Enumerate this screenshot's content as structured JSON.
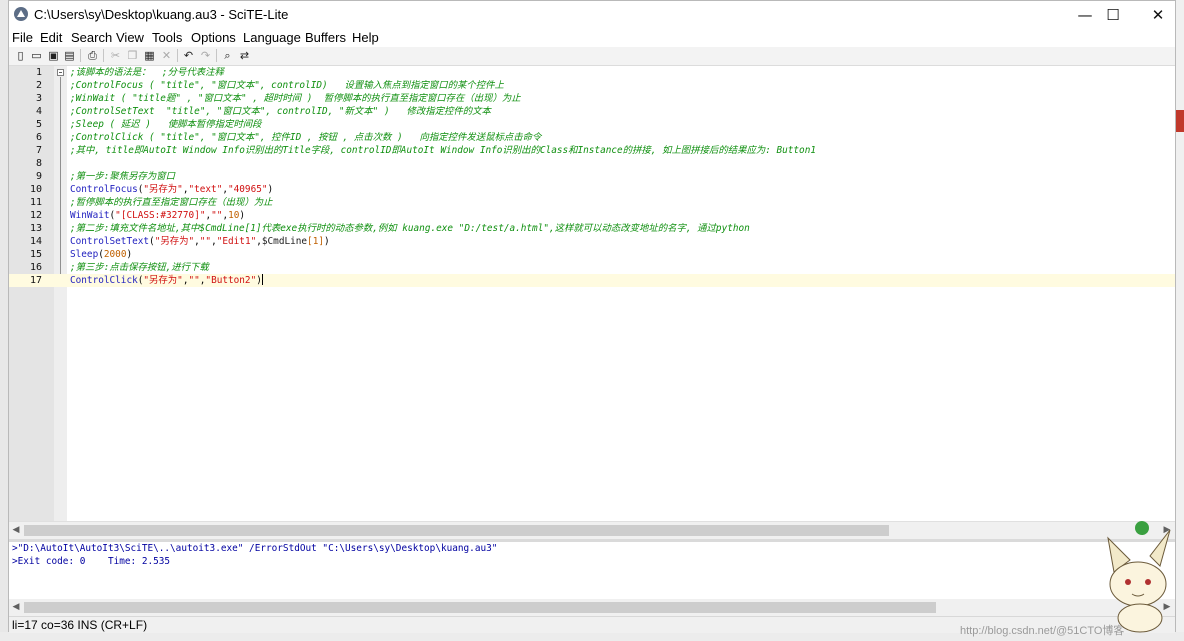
{
  "window": {
    "title": "C:\\Users\\sy\\Desktop\\kuang.au3 - SciTE-Lite",
    "minimize": "—",
    "maximize": "☐",
    "close": "✕"
  },
  "menu": [
    "File",
    "Edit",
    "Search",
    "View",
    "Tools",
    "Options",
    "Language",
    "Buffers",
    "Help"
  ],
  "toolbar_icons": [
    "new-file-icon",
    "open-folder-icon",
    "save-icon",
    "save-as-icon",
    "print-icon",
    "cut-icon",
    "copy-icon",
    "paste-icon",
    "delete-icon",
    "undo-icon",
    "redo-icon",
    "find-icon",
    "replace-icon"
  ],
  "editor": {
    "line_numbers": [
      "1",
      "2",
      "3",
      "4",
      "5",
      "6",
      "7",
      "8",
      "9",
      "10",
      "11",
      "12",
      "13",
      "14",
      "15",
      "16",
      "17"
    ],
    "lines": {
      "l1": ";该脚本的语法是：  ;分号代表注释",
      "l2": ";ControlFocus ( \"title\", \"窗口文本\", controlID)   设置输入焦点到指定窗口的某个控件上",
      "l3": ";WinWait ( \"title题\" , \"窗口文本\" , 超时时间 )  暂停脚本的执行直至指定窗口存在（出现）为止",
      "l4": ";ControlSetText  \"title\", \"窗口文本\", controlID, \"新文本\" )   修改指定控件的文本",
      "l5": ";Sleep ( 延迟 )   使脚本暂停指定时间段",
      "l6": ";ControlClick ( \"title\", \"窗口文本\", 控件ID , 按钮 , 点击次数 )   向指定控件发送鼠标点击命令",
      "l7": ";其中, title即AutoIt Window Info识别出的Title字段, controlID即AutoIt Window Info识别出的Class和Instance的拼接, 如上图拼接后的结果应为: Button1",
      "l9": ";第一步:聚焦另存为窗口",
      "l10": {
        "fn": "ControlFocus",
        "open": "(",
        "s1": "\"另存为\"",
        "c1": ",",
        "s2": "\"text\"",
        "c2": ",",
        "s3": "\"40965\"",
        "close": ")"
      },
      "l11": ";暂停脚本的执行直至指定窗口存在（出现）为止",
      "l12": {
        "fn": "WinWait",
        "open": "(",
        "s1": "\"[CLASS:#32770]\"",
        "c1": ",",
        "s2": "\"\"",
        "c2": ",",
        "n1": "10",
        "close": ")"
      },
      "l13": ";第二步:填充文件名地址,其中$CmdLine[1]代表exe执行时的动态参数,例如 kuang.exe \"D:/test/a.html\",这样就可以动态改变地址的名字, 通过python",
      "l14": {
        "fn": "ControlSetText",
        "open": "(",
        "s1": "\"另存为\"",
        "c1": ",",
        "s2": "\"\"",
        "c2": ",",
        "s3": "\"Edit1\"",
        "c3": ",",
        "var": "$CmdLine",
        "idx": "[1]",
        "close": ")"
      },
      "l15": {
        "fn": "Sleep",
        "open": "(",
        "n1": "2000",
        "close": ")"
      },
      "l16": ";第三步:点击保存按钮,进行下载",
      "l17": {
        "fn": "ControlClick",
        "open": "(",
        "s1": "\"另存为\"",
        "c1": ",",
        "s2": "\"\"",
        "c2": ",",
        "s3": "\"Button2\"",
        "close": ")"
      }
    }
  },
  "output": {
    "line1": ">\"D:\\AutoIt\\AutoIt3\\SciTE\\..\\autoit3.exe\" /ErrorStdOut \"C:\\Users\\sy\\Desktop\\kuang.au3\"",
    "line2": ">Exit code: 0    Time: 2.535"
  },
  "status": "li=17 co=36 INS (CR+LF)",
  "watermark": "http://blog.csdn.net/@51CTO博客",
  "colors": {
    "comment": "#109010",
    "function": "#1f1fbf",
    "string": "#d01010",
    "number": "#c06000",
    "current_line": "#fffbe0",
    "output_text": "#0000a0"
  }
}
